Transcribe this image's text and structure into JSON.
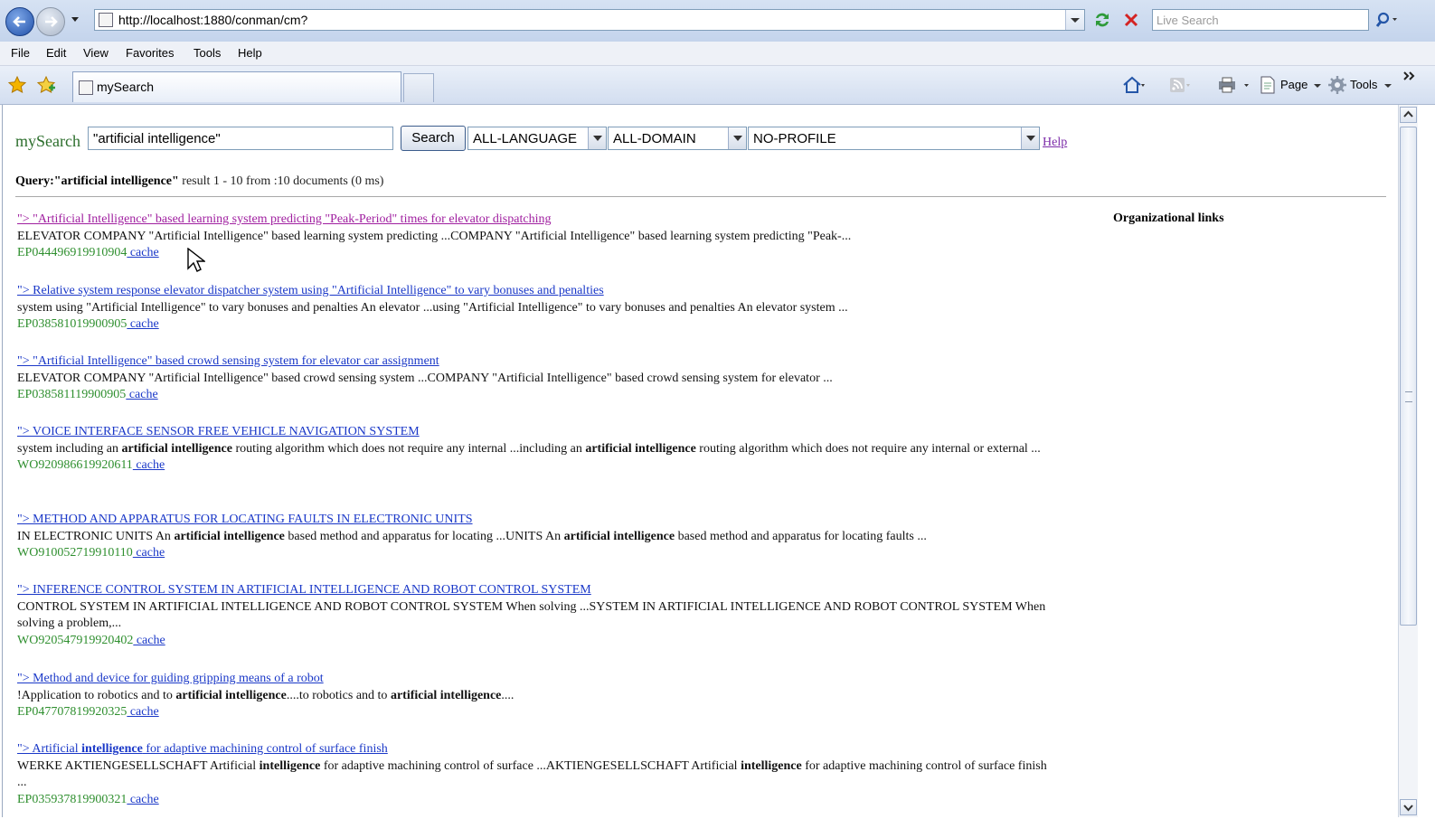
{
  "browser": {
    "url": "http://localhost:1880/conman/cm?",
    "live_search_placeholder": "Live Search",
    "menu": [
      "File",
      "Edit",
      "View",
      "Favorites",
      "Tools",
      "Help"
    ],
    "tab_title": "mySearch",
    "commands": {
      "page": "Page",
      "tools": "Tools"
    }
  },
  "search": {
    "brand": "mySearch",
    "query_value": "\"artificial intelligence\"",
    "button_label": "Search",
    "language": "ALL-LANGUAGE",
    "domain": "ALL-DOMAIN",
    "profile": "NO-PROFILE",
    "help_label": "Help"
  },
  "summary": {
    "query_label": "Query:\"artificial intelligence\"",
    "stats": " result 1 - 10 from :10 documents (0 ms)"
  },
  "sidebar": {
    "heading": "Organizational links"
  },
  "results": [
    {
      "title": "\"> \"Artificial Intelligence\" based learning system predicting \"Peak-Period\" times for elevator dispatching",
      "snippet": [
        {
          "t": "ELEVATOR COMPANY \"Artificial Intelligence\" based learning system predicting ...COMPANY \"Artificial Intelligence\" based learning system predicting \"Peak-...",
          "b": false
        }
      ],
      "id": "EP044496919910904",
      "cache": " cache"
    },
    {
      "title": "\"> Relative system response elevator dispatcher system using \"Artificial Intelligence\" to vary bonuses and penalties",
      "snippet": [
        {
          "t": "system using \"Artificial Intelligence\" to vary bonuses and penalties An elevator ...using \"Artificial Intelligence\" to vary bonuses and penalties An elevator system ...",
          "b": false
        }
      ],
      "id": "EP038581019900905",
      "cache": " cache"
    },
    {
      "title": "\"> \"Artificial Intelligence\" based crowd sensing system for elevator car assignment",
      "snippet": [
        {
          "t": "ELEVATOR COMPANY \"Artificial Intelligence\" based crowd sensing system ...COMPANY \"Artificial Intelligence\" based crowd sensing system for elevator ...",
          "b": false
        }
      ],
      "id": "EP038581119900905",
      "cache": " cache"
    },
    {
      "title": "\"> VOICE INTERFACE SENSOR FREE VEHICLE NAVIGATION SYSTEM",
      "snippet": [
        {
          "t": "system including an ",
          "b": false
        },
        {
          "t": "artificial intelligence",
          "b": true
        },
        {
          "t": " routing algorithm which does not require any internal ...including an ",
          "b": false
        },
        {
          "t": "artificial intelligence",
          "b": true
        },
        {
          "t": " routing algorithm which does not require any internal or external ...",
          "b": false
        }
      ],
      "id": "WO920986619920611",
      "cache": " cache"
    },
    {
      "title": "\"> METHOD AND APPARATUS FOR LOCATING FAULTS IN ELECTRONIC UNITS",
      "snippet": [
        {
          "t": "IN ELECTRONIC UNITS An ",
          "b": false
        },
        {
          "t": "artificial intelligence",
          "b": true
        },
        {
          "t": " based method and apparatus for locating ...UNITS An ",
          "b": false
        },
        {
          "t": "artificial intelligence",
          "b": true
        },
        {
          "t": " based method and apparatus for locating faults ...",
          "b": false
        }
      ],
      "id": "WO910052719910110",
      "cache": " cache"
    },
    {
      "title": "\"> INFERENCE CONTROL SYSTEM IN ARTIFICIAL INTELLIGENCE AND ROBOT CONTROL SYSTEM",
      "snippet": [
        {
          "t": "CONTROL SYSTEM IN ARTIFICIAL INTELLIGENCE AND ROBOT CONTROL SYSTEM When solving ...SYSTEM IN ARTIFICIAL INTELLIGENCE AND ROBOT CONTROL SYSTEM When solving a problem,...",
          "b": false
        }
      ],
      "id": "WO920547919920402",
      "cache": " cache"
    },
    {
      "title": "\"> Method and device for guiding gripping means of a robot",
      "snippet": [
        {
          "t": "!Application to robotics and to ",
          "b": false
        },
        {
          "t": "artificial intelligence",
          "b": true
        },
        {
          "t": "....to robotics and to ",
          "b": false
        },
        {
          "t": "artificial intelligence",
          "b": true
        },
        {
          "t": "....",
          "b": false
        }
      ],
      "id": "EP047707819920325",
      "cache": " cache"
    },
    {
      "title_parts": [
        {
          "t": "\"> Artificial ",
          "b": false
        },
        {
          "t": "intelligence",
          "b": true
        },
        {
          "t": " for adaptive machining control of surface finish",
          "b": false
        }
      ],
      "snippet": [
        {
          "t": "WERKE AKTIENGESELLSCHAFT Artificial ",
          "b": false
        },
        {
          "t": "intelligence",
          "b": true
        },
        {
          "t": " for adaptive machining control of surface ...AKTIENGESELLSCHAFT Artificial ",
          "b": false
        },
        {
          "t": "intelligence",
          "b": true
        },
        {
          "t": " for adaptive machining control of surface finish ...",
          "b": false
        }
      ],
      "id": "EP035937819900321",
      "cache": " cache"
    }
  ],
  "colors": {
    "link": "#1a38c8",
    "visited": "#a020a0",
    "doc_id": "#2f8f2f",
    "brand": "#2c6e2c"
  }
}
